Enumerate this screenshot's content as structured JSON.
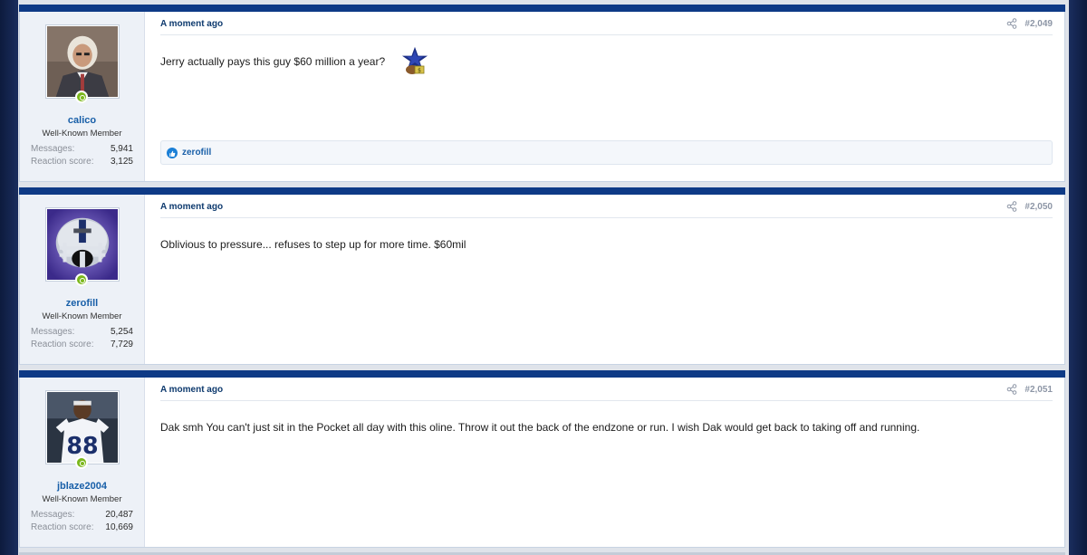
{
  "posts": [
    {
      "user": {
        "name": "calico",
        "title": "Well-Known Member",
        "avatar": "man-portrait-avatar"
      },
      "stats": {
        "messages_label": "Messages:",
        "messages": "5,941",
        "reaction_label": "Reaction score:",
        "reaction": "3,125"
      },
      "time": "A moment ago",
      "number": "#2,049",
      "text": "Jerry actually pays this guy $60 million a year?",
      "smiley": "cowboys-star-money-smiley",
      "reactions": {
        "icon": "thumbs-up-icon",
        "names": "zerofill"
      }
    },
    {
      "user": {
        "name": "zerofill",
        "title": "Well-Known Member",
        "avatar": "cowboys-helmet-avatar"
      },
      "stats": {
        "messages_label": "Messages:",
        "messages": "5,254",
        "reaction_label": "Reaction score:",
        "reaction": "7,729"
      },
      "time": "A moment ago",
      "number": "#2,050",
      "text": "Oblivious to pressure... refuses to step up for more time. $60mil"
    },
    {
      "user": {
        "name": "jblaze2004",
        "title": "Well-Known Member",
        "avatar": "player-88-avatar"
      },
      "stats": {
        "messages_label": "Messages:",
        "messages": "20,487",
        "reaction_label": "Reaction score:",
        "reaction": "10,669"
      },
      "time": "A moment ago",
      "number": "#2,051",
      "text": "Dak smh You can't just sit in the Pocket all day with this oline. Throw it out the back of the endzone or run. I wish Dak would get back to taking off and running."
    }
  ],
  "colors": {
    "header_bar": "#0e3a86",
    "username": "#185fa8",
    "online": "#7cb81d"
  }
}
